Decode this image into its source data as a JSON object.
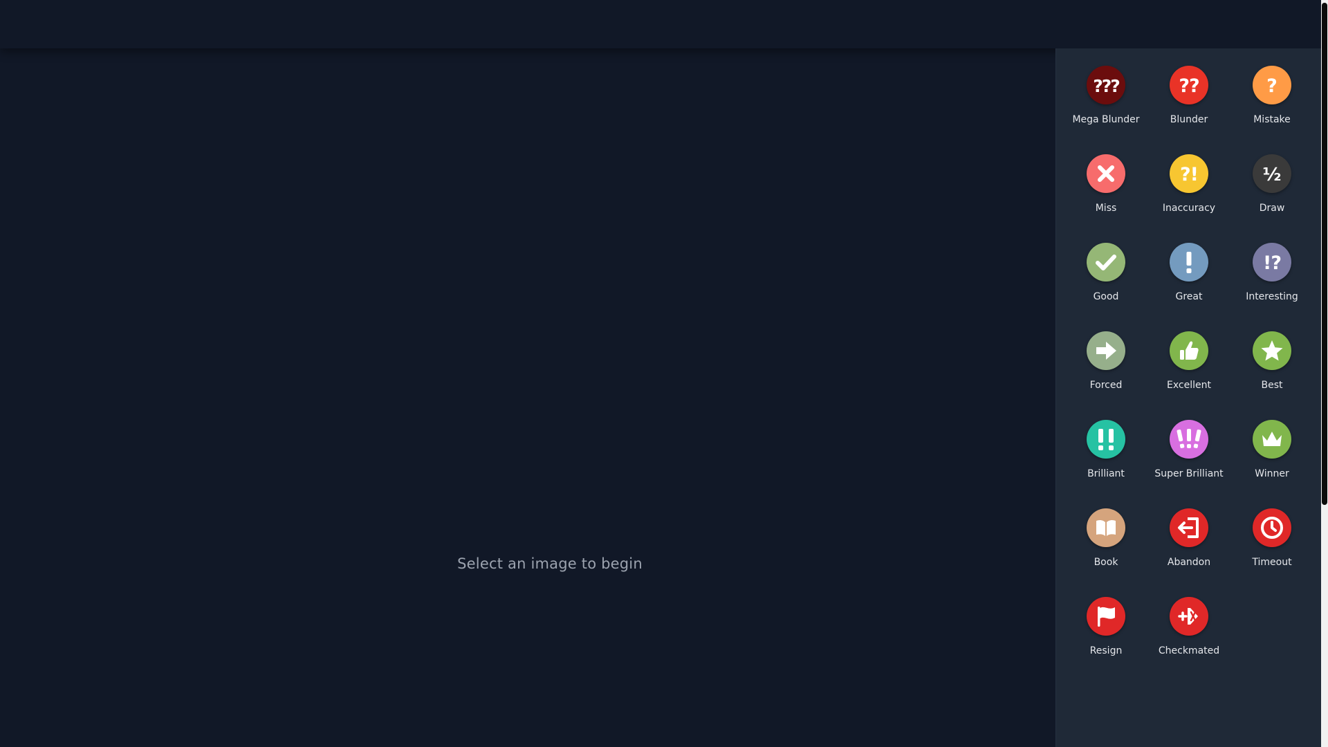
{
  "main": {
    "empty_message": "Select an image to begin"
  },
  "panel": {
    "items": [
      {
        "label": "Mega Blunder",
        "icon": "triple-question-icon",
        "color": "#6b0d0d"
      },
      {
        "label": "Blunder",
        "icon": "double-question-icon",
        "color": "#e93327"
      },
      {
        "label": "Mistake",
        "icon": "question-icon",
        "color": "#ff9b46"
      },
      {
        "label": "Miss",
        "icon": "x-icon",
        "color": "#f76c6c"
      },
      {
        "label": "Inaccuracy",
        "icon": "question-exclamation-icon",
        "color": "#f7c631"
      },
      {
        "label": "Draw",
        "icon": "half-icon",
        "color": "#3a3a3a"
      },
      {
        "label": "Good",
        "icon": "check-icon",
        "color": "#95b776"
      },
      {
        "label": "Great",
        "icon": "exclamation-icon",
        "color": "#749bbf"
      },
      {
        "label": "Interesting",
        "icon": "exclamation-question-icon",
        "color": "#7a7aa3"
      },
      {
        "label": "Forced",
        "icon": "arrow-right-icon",
        "color": "#96af8b"
      },
      {
        "label": "Excellent",
        "icon": "thumbs-up-icon",
        "color": "#81b64c"
      },
      {
        "label": "Best",
        "icon": "star-icon",
        "color": "#81b64c"
      },
      {
        "label": "Brilliant",
        "icon": "double-exclamation-icon",
        "color": "#26c2a3"
      },
      {
        "label": "Super Brilliant",
        "icon": "triple-exclamation-icon",
        "color": "#d86fe0"
      },
      {
        "label": "Winner",
        "icon": "crown-icon",
        "color": "#81b64c"
      },
      {
        "label": "Book",
        "icon": "book-icon",
        "color": "#d5a47d"
      },
      {
        "label": "Abandon",
        "icon": "exit-icon",
        "color": "#e02828"
      },
      {
        "label": "Timeout",
        "icon": "clock-icon",
        "color": "#e02828"
      },
      {
        "label": "Resign",
        "icon": "flag-icon",
        "color": "#e02828"
      },
      {
        "label": "Checkmated",
        "icon": "checkmated-icon",
        "color": "#e02828"
      }
    ]
  },
  "colors": {
    "background": "#111827",
    "panel": "#1f2937",
    "label_text": "#e5e7eb",
    "muted_text": "#9ca3af"
  }
}
